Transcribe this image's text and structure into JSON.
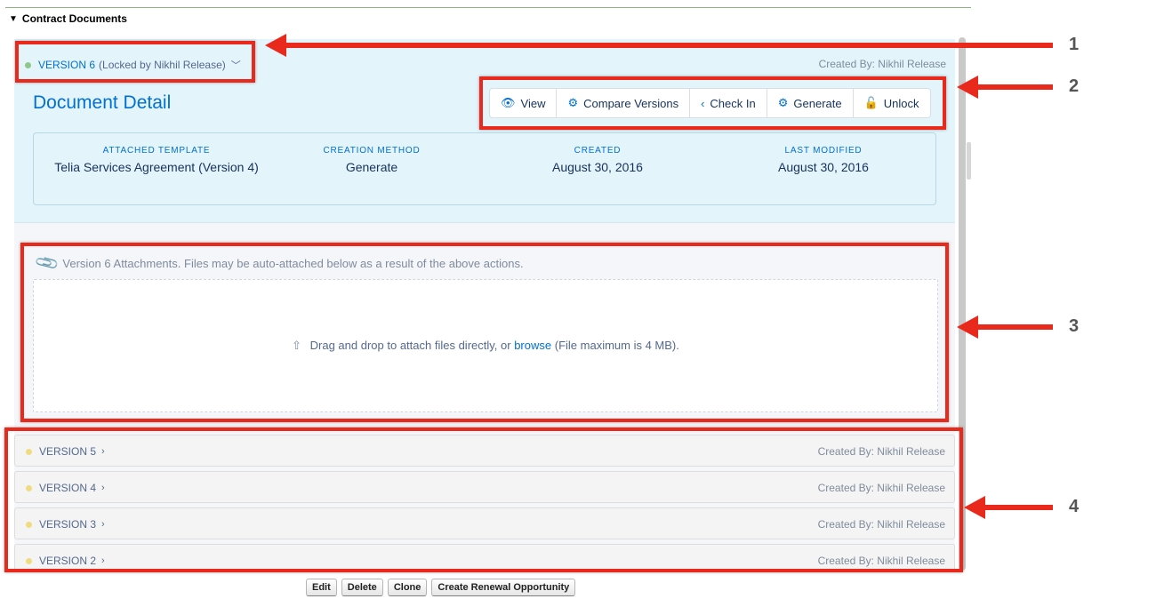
{
  "section": {
    "title": "Contract Documents"
  },
  "current_version": {
    "label": "VERSION 6",
    "note": "(Locked by Nikhil Release)",
    "created_by": "Created By: Nikhil Release",
    "status_color": "#8ec98b"
  },
  "detail": {
    "title": "Document Detail",
    "actions": [
      {
        "label": "View",
        "icon": "eye-icon"
      },
      {
        "label": "Compare Versions",
        "icon": "gears-icon"
      },
      {
        "label": "Check In",
        "icon": "chevron-left-icon"
      },
      {
        "label": "Generate",
        "icon": "gears-icon"
      },
      {
        "label": "Unlock",
        "icon": "unlock-icon"
      }
    ],
    "meta": [
      {
        "label": "ATTACHED TEMPLATE",
        "value": "Telia Services Agreement (Version 4)"
      },
      {
        "label": "CREATION METHOD",
        "value": "Generate"
      },
      {
        "label": "CREATED",
        "value": "August 30, 2016"
      },
      {
        "label": "LAST MODIFIED",
        "value": "August 30, 2016"
      }
    ]
  },
  "attachments": {
    "heading": "Version 6 Attachments. Files may be auto-attached below as a result of the above actions.",
    "drop_prefix": "Drag and drop to attach files directly, or",
    "browse_label": "browse",
    "drop_suffix": "(File maximum is 4 MB)."
  },
  "older_versions": [
    {
      "label": "VERSION 5",
      "created_by": "Created By: Nikhil Release"
    },
    {
      "label": "VERSION 4",
      "created_by": "Created By: Nikhil Release"
    },
    {
      "label": "VERSION 3",
      "created_by": "Created By: Nikhil Release"
    },
    {
      "label": "VERSION 2",
      "created_by": "Created By: Nikhil Release"
    }
  ],
  "callouts": [
    "1",
    "2",
    "3",
    "4"
  ],
  "bottom_buttons": [
    "Edit",
    "Delete",
    "Clone",
    "Create Renewal Opportunity"
  ],
  "colors": {
    "accent": "#0070d2",
    "highlight": "#e8291c",
    "panel_bg": "#e3f4fb"
  }
}
